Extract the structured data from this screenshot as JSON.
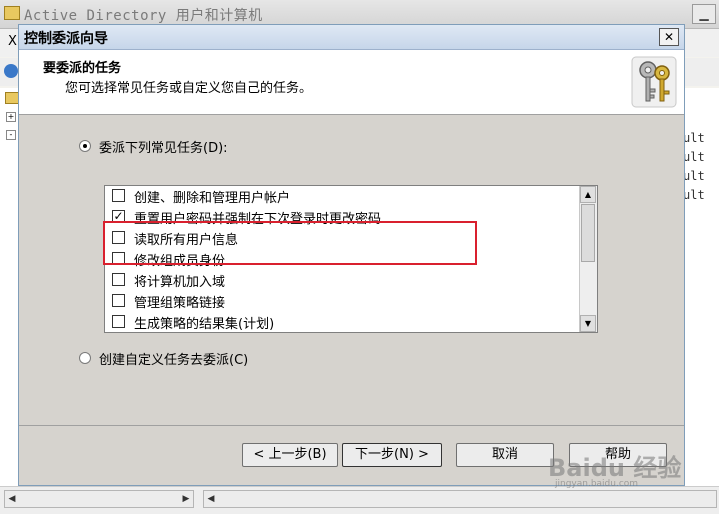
{
  "background": {
    "window_title": "Active Directory 用户和计算机",
    "menu_first": "X",
    "list_rows": [
      "ult",
      "ult",
      "ult",
      "ult"
    ]
  },
  "dialog": {
    "title": "控制委派向导",
    "close_label": "✕",
    "header_title": "要委派的任务",
    "header_subtitle": "您可选择常见任务或自定义您自己的任务。",
    "option_common_label": "委派下列常见任务(D):",
    "option_custom_label": "创建自定义任务去委派(C)",
    "tasks": [
      {
        "label": "创建、删除和管理用户帐户",
        "checked": false
      },
      {
        "label": "重置用户密码并强制在下次登录时更改密码",
        "checked": true
      },
      {
        "label": "读取所有用户信息",
        "checked": false
      },
      {
        "label": "修改组成员身份",
        "checked": false
      },
      {
        "label": "将计算机加入域",
        "checked": false
      },
      {
        "label": "管理组策略链接",
        "checked": false
      },
      {
        "label": "生成策略的结果集(计划)",
        "checked": false
      }
    ],
    "buttons": {
      "back": "< 上一步(B)",
      "next": "下一步(N) >",
      "cancel": "取消",
      "help": "帮助"
    }
  },
  "watermark": {
    "text": "Baidu 经验",
    "sub": "jingyan.baidu.com"
  }
}
